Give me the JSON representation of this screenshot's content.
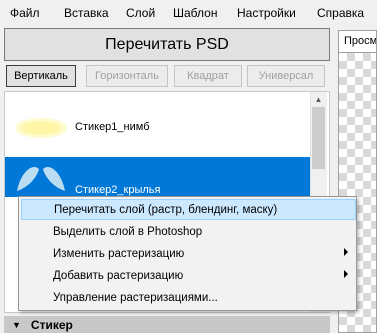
{
  "menubar": {
    "items": [
      "Файл",
      "Вставка",
      "Слой",
      "Шаблон",
      "Настройки",
      "Справка"
    ]
  },
  "main": {
    "reread_label": "Перечитать PSD",
    "orientation": [
      {
        "label": "Вертикаль",
        "state": "active"
      },
      {
        "label": "Горизонталь",
        "state": "disabled"
      },
      {
        "label": "Квадрат",
        "state": "disabled"
      },
      {
        "label": "Универсал",
        "state": "disabled"
      }
    ],
    "layers": [
      {
        "label": "Стикер1_нимб",
        "selected": false
      },
      {
        "label": "Стикер2_крылья",
        "selected": true
      }
    ],
    "section_label": "Стикер",
    "section_arrow": "chevron-down-icon"
  },
  "right_panel": {
    "tab_label": "Просмотр"
  },
  "context_menu": {
    "items": [
      {
        "label": "Перечитать слой (растр, блендинг, маску)",
        "highlighted": true,
        "submenu": false
      },
      {
        "label": "Выделить слой в Photoshop",
        "highlighted": false,
        "submenu": false
      },
      {
        "label": "Изменить растеризацию",
        "highlighted": false,
        "submenu": true
      },
      {
        "label": "Добавить растеризацию",
        "highlighted": false,
        "submenu": true
      },
      {
        "label": "Управление растеризациями...",
        "highlighted": false,
        "submenu": false
      }
    ]
  },
  "colors": {
    "selection": "#0078d7",
    "menu_highlight": "#cce8ff",
    "halo": "#fff8b0"
  }
}
